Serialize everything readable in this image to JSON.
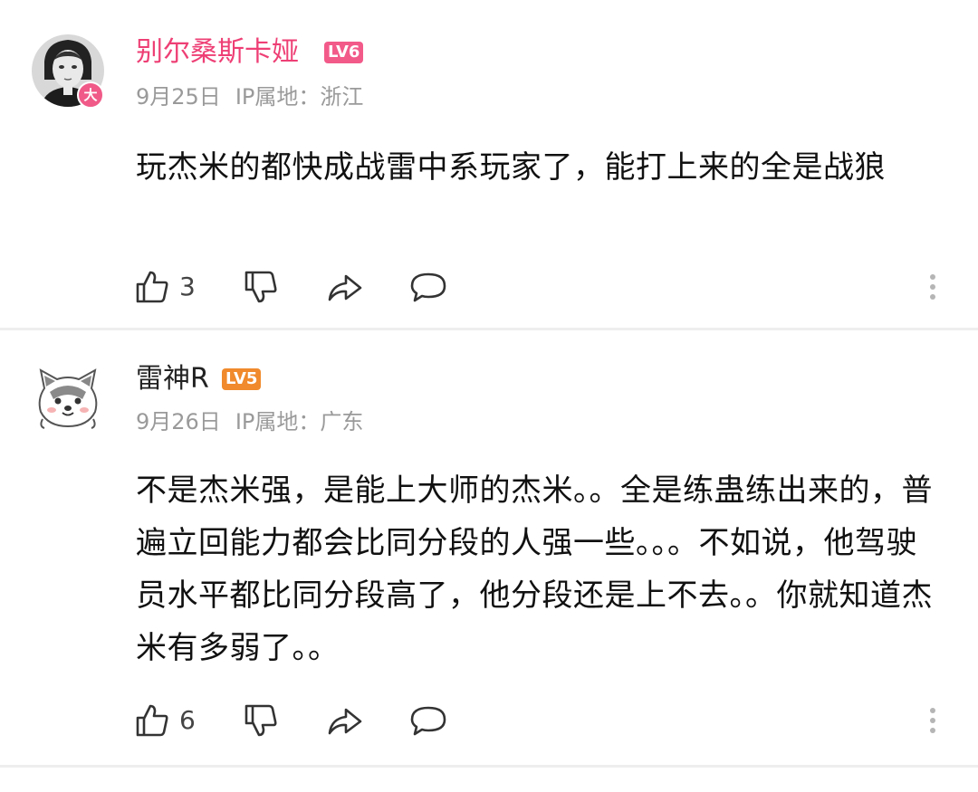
{
  "comments": [
    {
      "username": "别尔桑斯卡娅",
      "level": "LV6",
      "date": "9月25日",
      "ip": "IP属地：浙江",
      "avatar_badge": "大",
      "content": "玩杰米的都快成战雷中系玩家了，能打上来的全是战狼",
      "likes": "3",
      "username_color": "#ee3f75",
      "level_color": "#f25a8a"
    },
    {
      "username": "雷神R",
      "level": "LV5",
      "date": "9月26日",
      "ip": "IP属地：广东",
      "content": "不是杰米强，是能上大师的杰米。。全是练蛊练出来的，普遍立回能力都会比同分段的人强一些。。。不如说，他驾驶员水平都比同分段高了，他分段还是上不去。。你就知道杰米有多弱了。。",
      "likes": "6",
      "username_color": "#222222",
      "level_color": "#f08a2c"
    }
  ],
  "icons": [
    "like-icon",
    "dislike-icon",
    "share-icon",
    "reply-icon",
    "more-icon"
  ]
}
